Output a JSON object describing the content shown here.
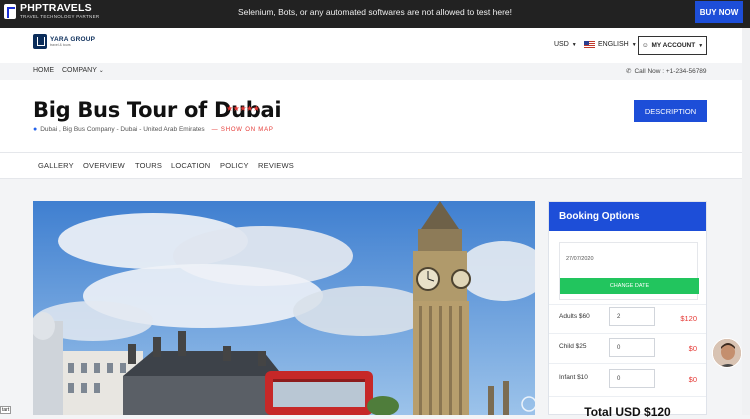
{
  "topbar": {
    "brand_name": "PHPTRAVELS",
    "brand_sub": "TRAVEL TECHNOLOGY PARTNER",
    "notice": "Selenium, Bots, or any automated softwares are not allowed to test here!",
    "buy_label": "BUY NOW",
    "accent": "#1d4ed8"
  },
  "header": {
    "logo_text": "YARA GROUP",
    "logo_sub": "travel & tours",
    "currency": "USD",
    "language": "ENGLISH",
    "account": "MY ACCOUNT"
  },
  "nav": {
    "home": "HOME",
    "company": "COMPANY",
    "call": "Call Now : +1-234-56789"
  },
  "listing": {
    "title": "Big Bus Tour of Dubai",
    "stars": "★★★★★",
    "rating": 5,
    "location": "Dubai , Big Bus Company - Dubai - United Arab Emirates",
    "show_map": "SHOW ON MAP",
    "description_label": "DESCRIPTION"
  },
  "tabs": [
    "GALLERY",
    "OVERVIEW",
    "TOURS",
    "LOCATION",
    "POLICY",
    "REVIEWS"
  ],
  "booking": {
    "title": "Booking Options",
    "date": "27/07/2020",
    "change_date": "CHANGE DATE",
    "rows": [
      {
        "label": "Adults $60",
        "value": "2",
        "price": "$120"
      },
      {
        "label": "Child $25",
        "value": "0",
        "price": "$0"
      },
      {
        "label": "Infant $10",
        "value": "0",
        "price": "$0"
      }
    ],
    "total": "Total USD $120"
  },
  "misc": {
    "corner_tag": "tart"
  }
}
